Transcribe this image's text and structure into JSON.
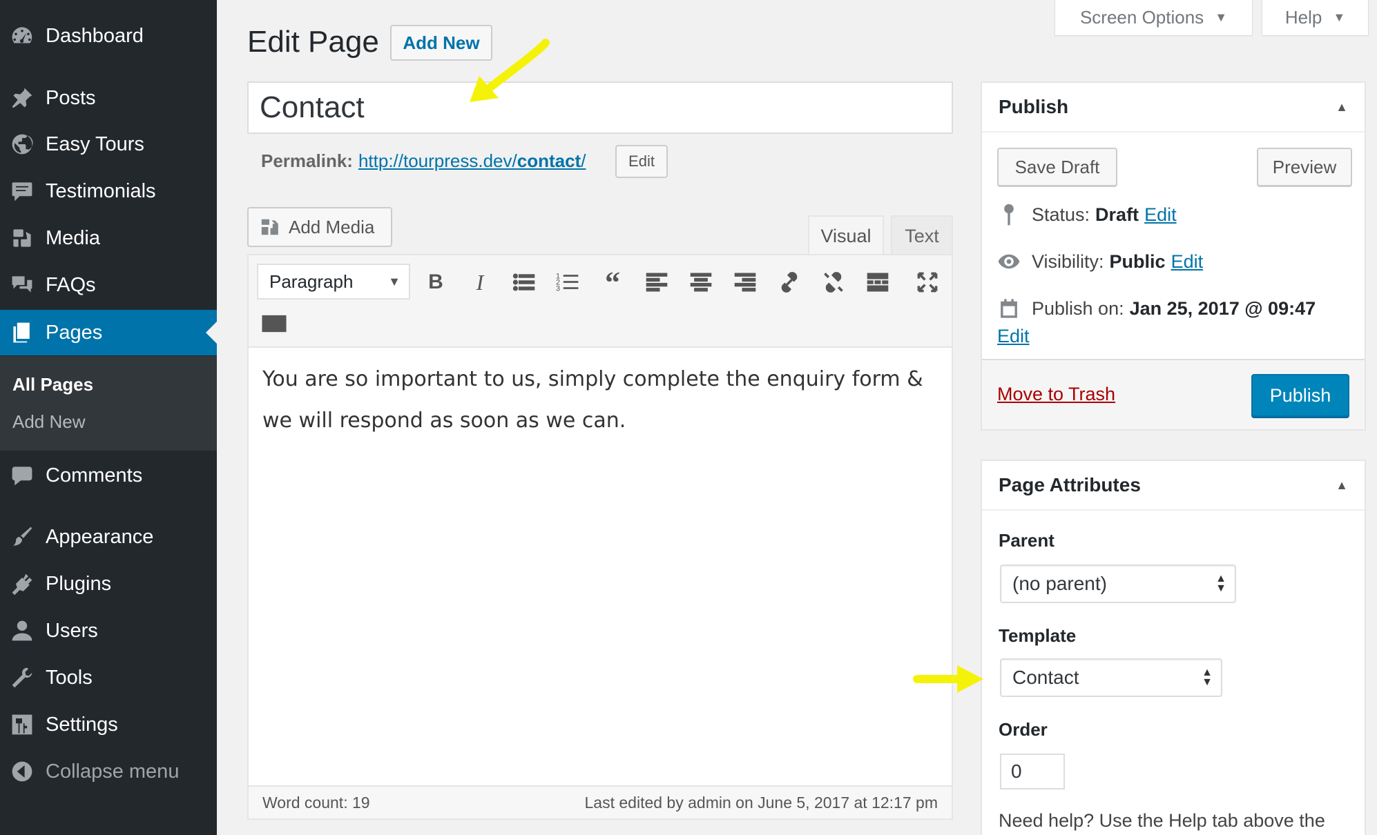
{
  "sidebar": {
    "items": [
      {
        "label": "Dashboard",
        "icon": "dashboard-icon"
      },
      {
        "label": "Posts",
        "icon": "pin-icon"
      },
      {
        "label": "Easy Tours",
        "icon": "globe-icon"
      },
      {
        "label": "Testimonials",
        "icon": "comment-icon"
      },
      {
        "label": "Media",
        "icon": "media-icon"
      },
      {
        "label": "FAQs",
        "icon": "chat-icon"
      },
      {
        "label": "Pages",
        "icon": "pages-icon"
      },
      {
        "label": "Comments",
        "icon": "comment-icon"
      },
      {
        "label": "Appearance",
        "icon": "brush-icon"
      },
      {
        "label": "Plugins",
        "icon": "plugin-icon"
      },
      {
        "label": "Users",
        "icon": "user-icon"
      },
      {
        "label": "Tools",
        "icon": "wrench-icon"
      },
      {
        "label": "Settings",
        "icon": "settings-icon"
      },
      {
        "label": "Collapse menu",
        "icon": "collapse-icon"
      }
    ],
    "submenu": {
      "all_pages": "All Pages",
      "add_new": "Add New"
    }
  },
  "top": {
    "screen_options": "Screen Options",
    "help": "Help"
  },
  "heading": {
    "title": "Edit Page",
    "add_new": "Add New"
  },
  "post": {
    "title": "Contact",
    "permalink_label": "Permalink:",
    "permalink_base": "http://tourpress.dev/",
    "permalink_slug": "contact",
    "permalink_end": "/",
    "permalink_edit": "Edit"
  },
  "editor": {
    "add_media": "Add Media",
    "tab_visual": "Visual",
    "tab_text": "Text",
    "format": "Paragraph",
    "content": "You are so important to us, simply complete the enquiry form & we will respond as soon as we can.",
    "word_count": "Word count: 19",
    "last_edited": "Last edited by admin on June 5, 2017 at 12:17 pm"
  },
  "publish": {
    "title": "Publish",
    "save_draft": "Save Draft",
    "preview": "Preview",
    "status_label": "Status:",
    "status_value": "Draft",
    "visibility_label": "Visibility:",
    "visibility_value": "Public",
    "publish_on_label": "Publish on:",
    "publish_on_value": "Jan 25, 2017 @ 09:47",
    "edit": "Edit",
    "move_to_trash": "Move to Trash",
    "publish_button": "Publish"
  },
  "attributes": {
    "title": "Page Attributes",
    "parent_label": "Parent",
    "parent_value": "(no parent)",
    "template_label": "Template",
    "template_value": "Contact",
    "order_label": "Order",
    "order_value": "0",
    "help_text": "Need help? Use the Help tab above the"
  },
  "colors": {
    "sidebar_bg": "#23282d",
    "active": "#0073aa",
    "publish": "#0085ba",
    "arrow": "#f5f20a"
  }
}
